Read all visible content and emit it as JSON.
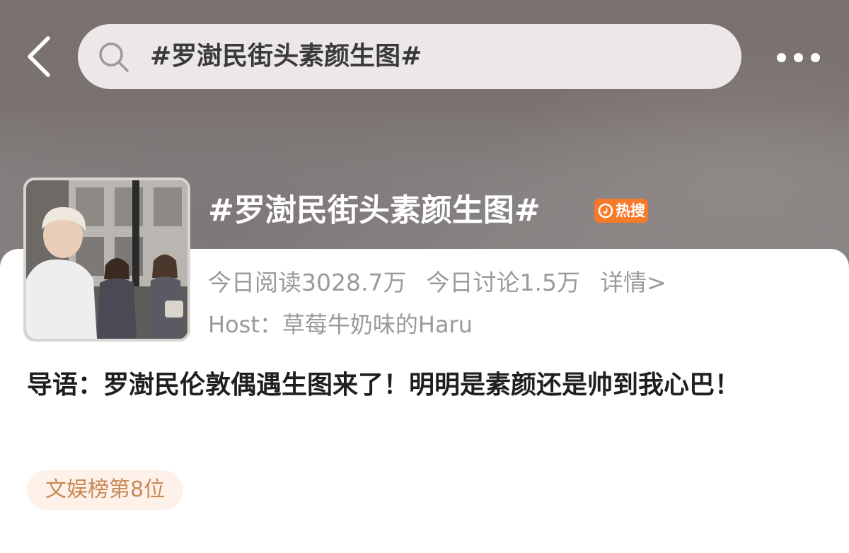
{
  "search": {
    "query": "#罗澍民街头素颜生图#"
  },
  "topic": {
    "title": "#罗澍民街头素颜生图#",
    "hot_badge": "热搜",
    "reads_label": "今日阅读3028.7万",
    "discussions_label": "今日讨论1.5万",
    "details_link": "详情>",
    "host_label": "Host：",
    "host_name": "草莓牛奶味的Haru"
  },
  "intro": {
    "text": "导语：罗澍民伦敦偶遇生图来了！明明是素颜还是帅到我心巴！"
  },
  "rank_tag": {
    "label": "文娱榜第8位"
  },
  "icons": {
    "back": "chevron-left-icon",
    "search": "search-icon",
    "more": "more-dots-icon",
    "hot": "fire-icon"
  },
  "colors": {
    "hot_badge": "#f77a2b",
    "rank_tag_text": "#c98a57",
    "rank_tag_bg": "#fdf1e9",
    "meta_text": "#9a9a9a"
  }
}
